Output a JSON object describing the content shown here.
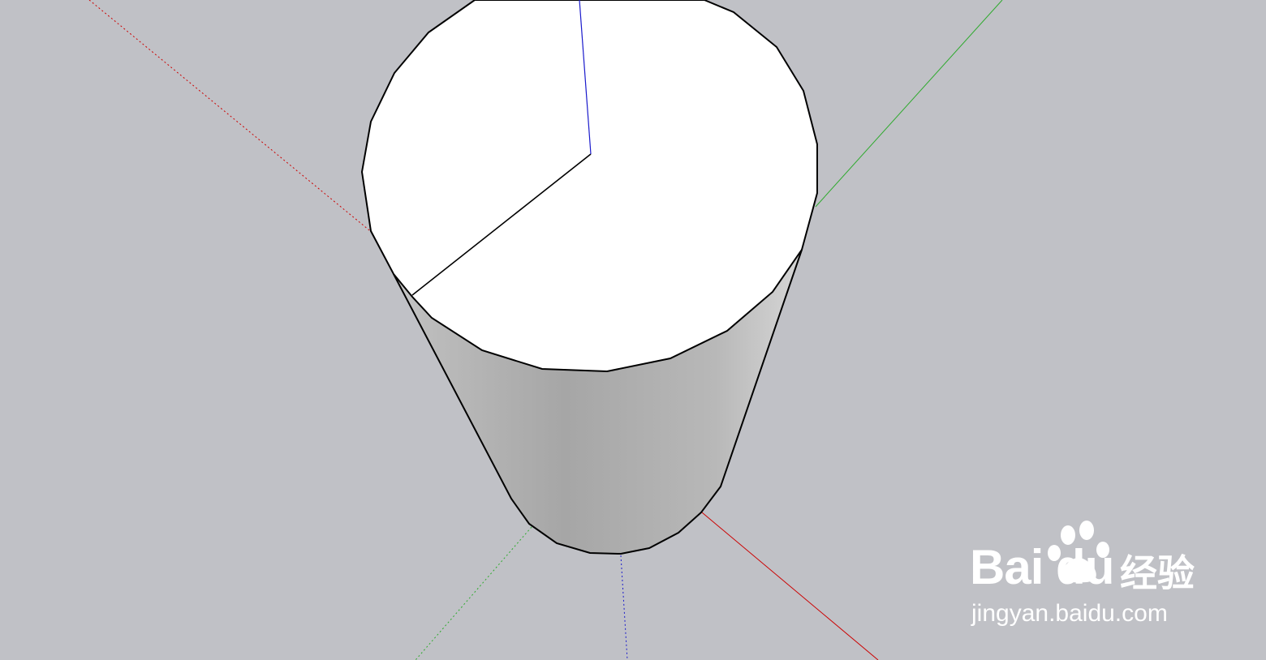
{
  "scene": {
    "background_color": "#c0c1c6",
    "axes": {
      "red_color": "#cc0000",
      "green_color": "#2eaa2e",
      "blue_color": "#1a1acc"
    },
    "cylinder": {
      "top_face_color": "#ffffff",
      "side_color": "#a9a9a9",
      "edge_color": "#000000"
    }
  },
  "watermark": {
    "brand": "Bai  du",
    "chinese": "经验",
    "url": "jingyan.baidu.com",
    "logo": "paw-icon"
  }
}
